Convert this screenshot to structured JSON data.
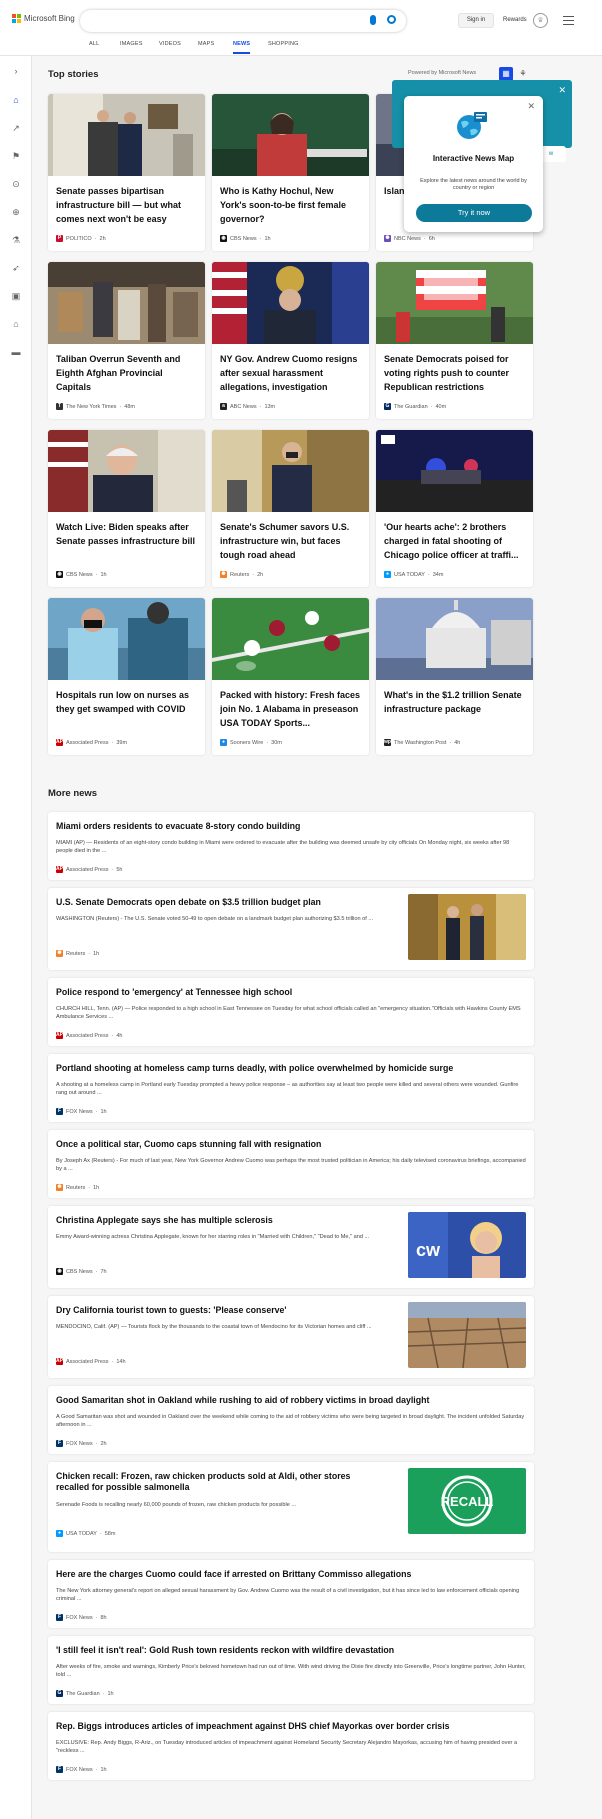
{
  "header": {
    "logo_text": "Microsoft Bing",
    "signin_label": "Sign in",
    "rewards_label": "Rewards"
  },
  "tabs": [
    "ALL",
    "IMAGES",
    "VIDEOS",
    "MAPS",
    "NEWS",
    "SHOPPING"
  ],
  "active_tab": "NEWS",
  "top_stories": {
    "title": "Top stories",
    "powered_by": "Powered by Microsoft News",
    "cards": [
      {
        "title": "Senate passes bipartisan infrastructure bill — but what comes next won't be easy",
        "source": "POLITICO",
        "time": "2h",
        "icon": "P",
        "icon_color": "#c8102e"
      },
      {
        "title": "Who is Kathy Hochul, New York's soon-to-be first female governor?",
        "source": "CBS News",
        "time": "1h",
        "icon": "◉",
        "icon_color": "#111111"
      },
      {
        "title": "Island extinc 'our w",
        "source": "NBC News",
        "time": "6h",
        "icon": "✺",
        "icon_color": "#6b4fbb"
      },
      {
        "title": "Taliban Overrun Seventh and Eighth Afghan Provincial Capitals",
        "source": "The New York Times",
        "time": "48m",
        "icon": "T",
        "icon_color": "#333333"
      },
      {
        "title": "NY Gov. Andrew Cuomo resigns after sexual harassment allegations, investigation",
        "source": "ABC News",
        "time": "13m",
        "icon": "a",
        "icon_color": "#222222"
      },
      {
        "title": "Senate Democrats poised for voting rights push to counter Republican restrictions",
        "source": "The Guardian",
        "time": "40m",
        "icon": "G",
        "icon_color": "#052962"
      },
      {
        "title": "Watch Live: Biden speaks after Senate passes infrastructure bill",
        "source": "CBS News",
        "time": "1h",
        "icon": "◉",
        "icon_color": "#111111"
      },
      {
        "title": "Senate's Schumer savors U.S. infrastructure win, but faces tough road ahead",
        "source": "Reuters",
        "time": "2h",
        "icon": "✺",
        "icon_color": "#f58025"
      },
      {
        "title": "'Our hearts ache': 2 brothers charged in fatal shooting of Chicago police officer at traffi...",
        "source": "USA TODAY",
        "time": "34m",
        "icon": "●",
        "icon_color": "#009bff"
      },
      {
        "title": "Hospitals run low on nurses as they get swamped with COVID",
        "source": "Associated Press",
        "time": "39m",
        "icon": "AP",
        "icon_color": "#cc0000"
      },
      {
        "title": "Packed with history: Fresh faces join No. 1 Alabama in preseason USA TODAY Sports...",
        "source": "Sooners Wire",
        "time": "30m",
        "icon": "●",
        "icon_color": "#1e88e5"
      },
      {
        "title": "What's in the $1.2 trillion Senate infrastructure package",
        "source": "The Washington Post",
        "time": "4h",
        "icon": "wp",
        "icon_color": "#222222"
      }
    ]
  },
  "popup": {
    "title": "Interactive News Map",
    "description": "Explore the latest news around the world by country or region",
    "button_label": "Try it now",
    "behind_button_label": "w"
  },
  "more_news": {
    "title": "More news",
    "items": [
      {
        "title": "Miami orders residents to evacuate 8-story condo building",
        "snippet": "MIAMI (AP) — Residents of an eight-story condo building in Miami were ordered to evacuate after the building was deemed unsafe by city officials On Monday night, six weeks after 98 people died in the ...",
        "source": "Associated Press",
        "time": "5h",
        "icon": "AP",
        "icon_color": "#cc0000"
      },
      {
        "title": "U.S. Senate Democrats open debate on $3.5 trillion budget plan",
        "snippet": "WASHINGTON (Reuters) - The U.S. Senate voted 50-49 to open debate on a landmark budget plan authorizing $3.5 trillion of ...",
        "source": "Reuters",
        "time": "1h",
        "icon": "✺",
        "icon_color": "#f58025"
      },
      {
        "title": "Police respond to 'emergency' at Tennessee high school",
        "snippet": "CHURCH HILL, Tenn. (AP) — Police responded to a high school in East Tennessee on Tuesday for what school officials called an \"emergency situation.\"Officials with Hawkins County EMS Ambulance Services ...",
        "source": "Associated Press",
        "time": "4h",
        "icon": "AP",
        "icon_color": "#cc0000"
      },
      {
        "title": "Portland shooting at homeless camp turns deadly, with police overwhelmed by homicide surge",
        "snippet": "A shooting at a homeless camp in Portland early Tuesday prompted a heavy police response – as authorities say at least two people were killed and several others were wounded. Gunfire rang out around ...",
        "source": "FOX News",
        "time": "1h",
        "icon": "F",
        "icon_color": "#003366"
      },
      {
        "title": "Once a political star, Cuomo caps stunning fall with resignation",
        "snippet": "By Joseph Ax (Reuters) - For much of last year, New York Governor Andrew Cuomo was perhaps the most trusted politician in America; his daily televised coronavirus briefings, accompanied by a ...",
        "source": "Reuters",
        "time": "1h",
        "icon": "✺",
        "icon_color": "#f58025"
      },
      {
        "title": "Christina Applegate says she has multiple sclerosis",
        "snippet": "Emmy Award-winning actress Christina Applegate, known for her starring roles in \"Married with Children,\" \"Dead to Me,\" and ...",
        "source": "CBS News",
        "time": "7h",
        "icon": "◉",
        "icon_color": "#111111"
      },
      {
        "title": "Dry California tourist town to guests: 'Please conserve'",
        "snippet": "MENDOCINO, Calif. (AP) — Tourists flock by the thousands to the coastal town of Mendocino for its Victorian homes and cliff ...",
        "source": "Associated Press",
        "time": "14h",
        "icon": "AP",
        "icon_color": "#cc0000"
      },
      {
        "title": "Good Samaritan shot in Oakland while rushing to aid of robbery victims in broad daylight",
        "snippet": "A Good Samaritan was shot and wounded in Oakland over the weekend while coming to the aid of robbery victims who were being targeted in broad daylight.  The incident unfolded Saturday afternoon in ...",
        "source": "FOX News",
        "time": "2h",
        "icon": "F",
        "icon_color": "#003366"
      },
      {
        "title": "Chicken recall: Frozen, raw chicken products sold at Aldi, other stores recalled for possible salmonella",
        "snippet": "Serenade Foods is recalling nearly 60,000 pounds of frozen, raw chicken products for possible ...",
        "source": "USA TODAY",
        "time": "58m",
        "icon": "●",
        "icon_color": "#009bff",
        "image_text": "RECALL"
      },
      {
        "title": "Here are the charges Cuomo could face if arrested on Brittany Commisso allegations",
        "snippet": "The New York attorney general's report on alleged sexual harassment by Gov. Andrew Cuomo was the result of a civil investigation, but it has since led to law enforcement officials opening criminal ...",
        "source": "FOX News",
        "time": "8h",
        "icon": "F",
        "icon_color": "#003366"
      },
      {
        "title": "'I still feel it isn't real': Gold Rush town residents reckon with wildfire devastation",
        "snippet": "After weeks of fire, smoke and warnings, Kimberly Price's beloved hometown had run out of time. With wind driving the Dixie fire directly into Greenville, Price's longtime partner, John Hunter, told ...",
        "source": "The Guardian",
        "time": "1h",
        "icon": "G",
        "icon_color": "#052962"
      },
      {
        "title": "Rep. Biggs introduces articles of impeachment against DHS chief Mayorkas over border crisis",
        "snippet": "EXCLUSIVE: Rep. Andy Biggs, R-Ariz., on Tuesday introduced articles of impeachment against Homeland Security Secretary Alejandro Mayorkas, accusing him of having presided over a \"reckless ...",
        "source": "FOX News",
        "time": "1h",
        "icon": "F",
        "icon_color": "#003366"
      }
    ]
  }
}
